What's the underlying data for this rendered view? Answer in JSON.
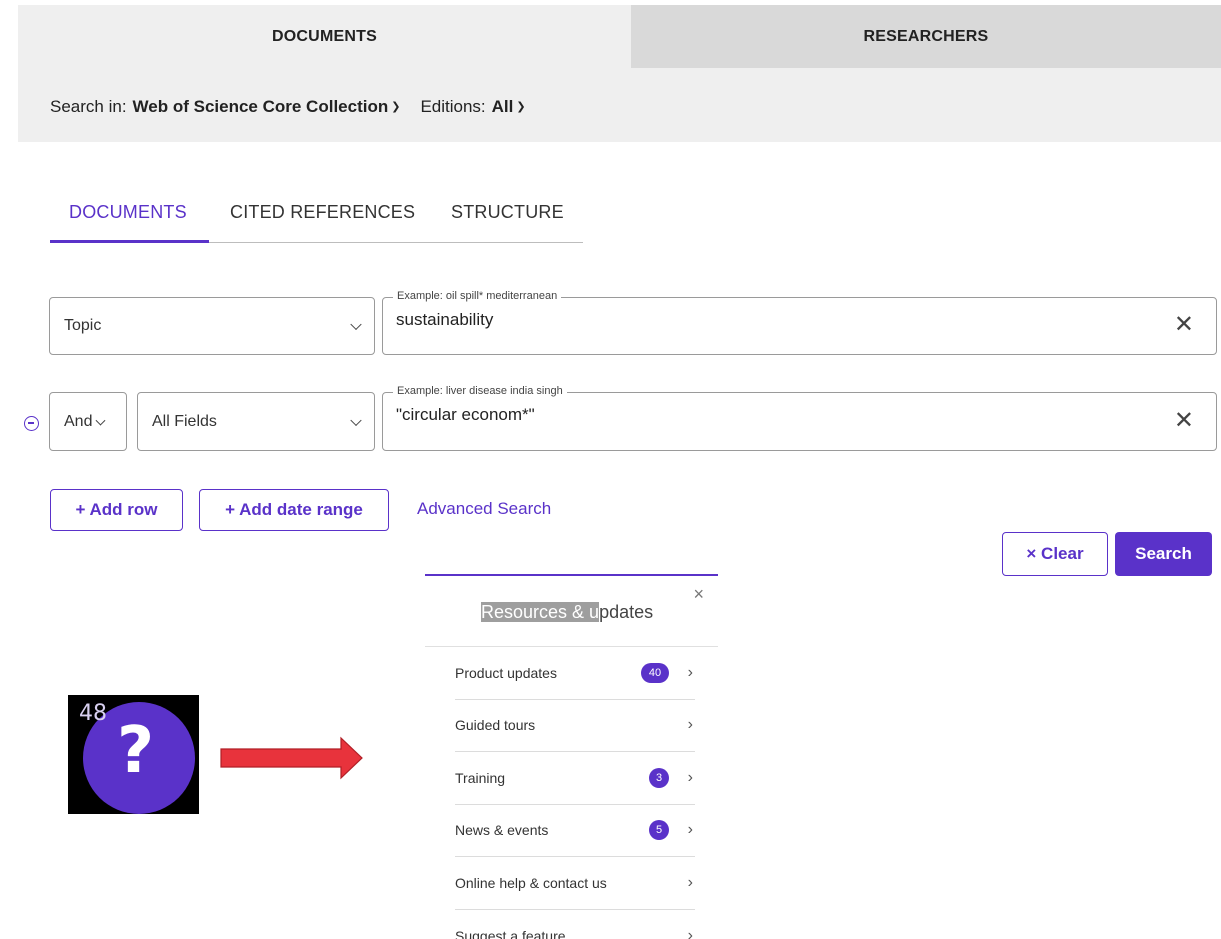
{
  "top_tabs": {
    "documents": "DOCUMENTS",
    "researchers": "RESEARCHERS"
  },
  "search_in": {
    "label": "Search in:",
    "collection": "Web of Science Core Collection",
    "editions_label": "Editions:",
    "editions_value": "All"
  },
  "sub_tabs": [
    "DOCUMENTS",
    "CITED REFERENCES",
    "STRUCTURE"
  ],
  "rows": [
    {
      "field": "Topic",
      "placeholder": "Example: oil spill* mediterranean",
      "value": "sustainability"
    },
    {
      "operator": "And",
      "field": "All Fields",
      "placeholder": "Example: liver disease india singh",
      "value": "\"circular econom*\""
    }
  ],
  "actions": {
    "add_row": "+ Add row",
    "add_date_range": "+ Add date range",
    "advanced": "Advanced Search",
    "clear": "× Clear",
    "search": "Search"
  },
  "help_badge": {
    "count": "48",
    "symbol": "?"
  },
  "resources": {
    "title_highlighted": "Resources & u",
    "title_rest": "pdates",
    "close": "×",
    "items": [
      {
        "label": "Product updates",
        "badge": "40"
      },
      {
        "label": "Guided tours",
        "badge": ""
      },
      {
        "label": "Training",
        "badge": "3"
      },
      {
        "label": "News & events",
        "badge": "5"
      },
      {
        "label": "Online help & contact us",
        "badge": ""
      },
      {
        "label": "Suggest a feature",
        "badge": ""
      }
    ]
  },
  "colors": {
    "accent": "#5a32c9",
    "arrow": "#e8333c"
  }
}
